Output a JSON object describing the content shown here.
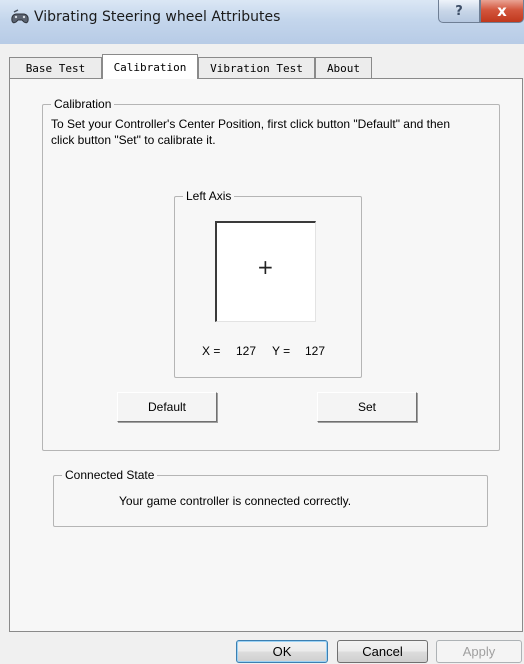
{
  "window": {
    "title": "Vibrating Steering wheel Attributes",
    "help_glyph": "?",
    "close_glyph": "x",
    "icon": "game-controller-icon"
  },
  "tabs": [
    {
      "label": "Base Test",
      "active": false
    },
    {
      "label": "Calibration",
      "active": true
    },
    {
      "label": "Vibration Test",
      "active": false
    },
    {
      "label": "About",
      "active": false
    }
  ],
  "calibration": {
    "legend": "Calibration",
    "instructions": "To Set your Controller's  Center Position, first click button \"Default\" and then click button \"Set\" to calibrate it."
  },
  "left_axis": {
    "legend": "Left Axis",
    "crosshair": "+",
    "x_label": "X =",
    "x_value": "127",
    "y_label": "Y =",
    "y_value": "127"
  },
  "buttons": {
    "default": "Default",
    "set": "Set",
    "ok": "OK",
    "cancel": "Cancel",
    "apply": "Apply"
  },
  "connected_state": {
    "legend": "Connected State",
    "message": "Your game controller is connected correctly."
  }
}
